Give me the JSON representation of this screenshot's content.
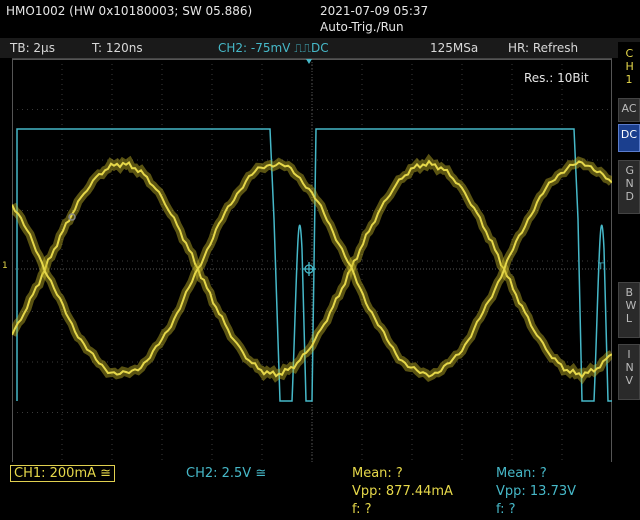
{
  "header": {
    "device": "HMO1002 (HW 0x10180003; SW 05.886)",
    "datetime": "2021-07-09 05:37",
    "trigger_mode": "Auto-Trig./Run"
  },
  "status": {
    "timebase": "TB: 2µs",
    "trigger_time": "T: 120ns",
    "trigger_setting": "CH2: -75mV ⎍⎍DC",
    "sample_rate": "125MSa",
    "acq_mode": "HR: Refresh"
  },
  "screen": {
    "resolution": "Res.: 10Bit",
    "ch1_marker": "1",
    "trigger_marker": "T"
  },
  "side_buttons": {
    "channel": "CH1",
    "ac": "AC",
    "dc": "DC",
    "gnd": "GND",
    "bwl": "BWL",
    "inv": "INV"
  },
  "footer": {
    "ch1_scale": "CH1: 200mA ≅",
    "ch2_scale": "CH2: 2.5V ≅",
    "ch1_mean": "Mean: ?",
    "ch1_vpp": "Vpp: 877.44mA",
    "ch1_freq": "f: ?",
    "ch2_mean": "Mean: ?",
    "ch2_vpp": "Vpp: 13.73V",
    "ch2_freq": "f: ?"
  },
  "colors": {
    "ch1": "#e6d84a",
    "ch2": "#46b8c8",
    "active_button": "#1b3f8e",
    "grid": "#3a3a3a"
  }
}
